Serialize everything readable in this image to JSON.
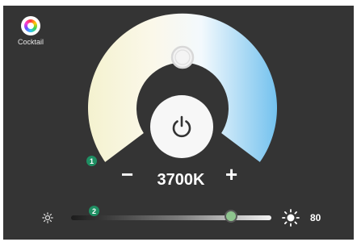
{
  "app": {
    "name": "Cocktail"
  },
  "dial": {
    "color_temperature": "3700K",
    "power_icon": "power-icon",
    "minus_label": "−",
    "plus_label": "+",
    "warm_color": "#f6f3dc",
    "cool_color": "#7cc7ef",
    "marker_badge": "1"
  },
  "brightness": {
    "value": 80,
    "value_label": "80",
    "marker_badge": "2",
    "low_icon": "sun-small-icon",
    "high_icon": "sun-large-icon"
  },
  "colors": {
    "background": "#343434",
    "badge": "#1f8f63",
    "slider_thumb": "#8ec48e"
  }
}
